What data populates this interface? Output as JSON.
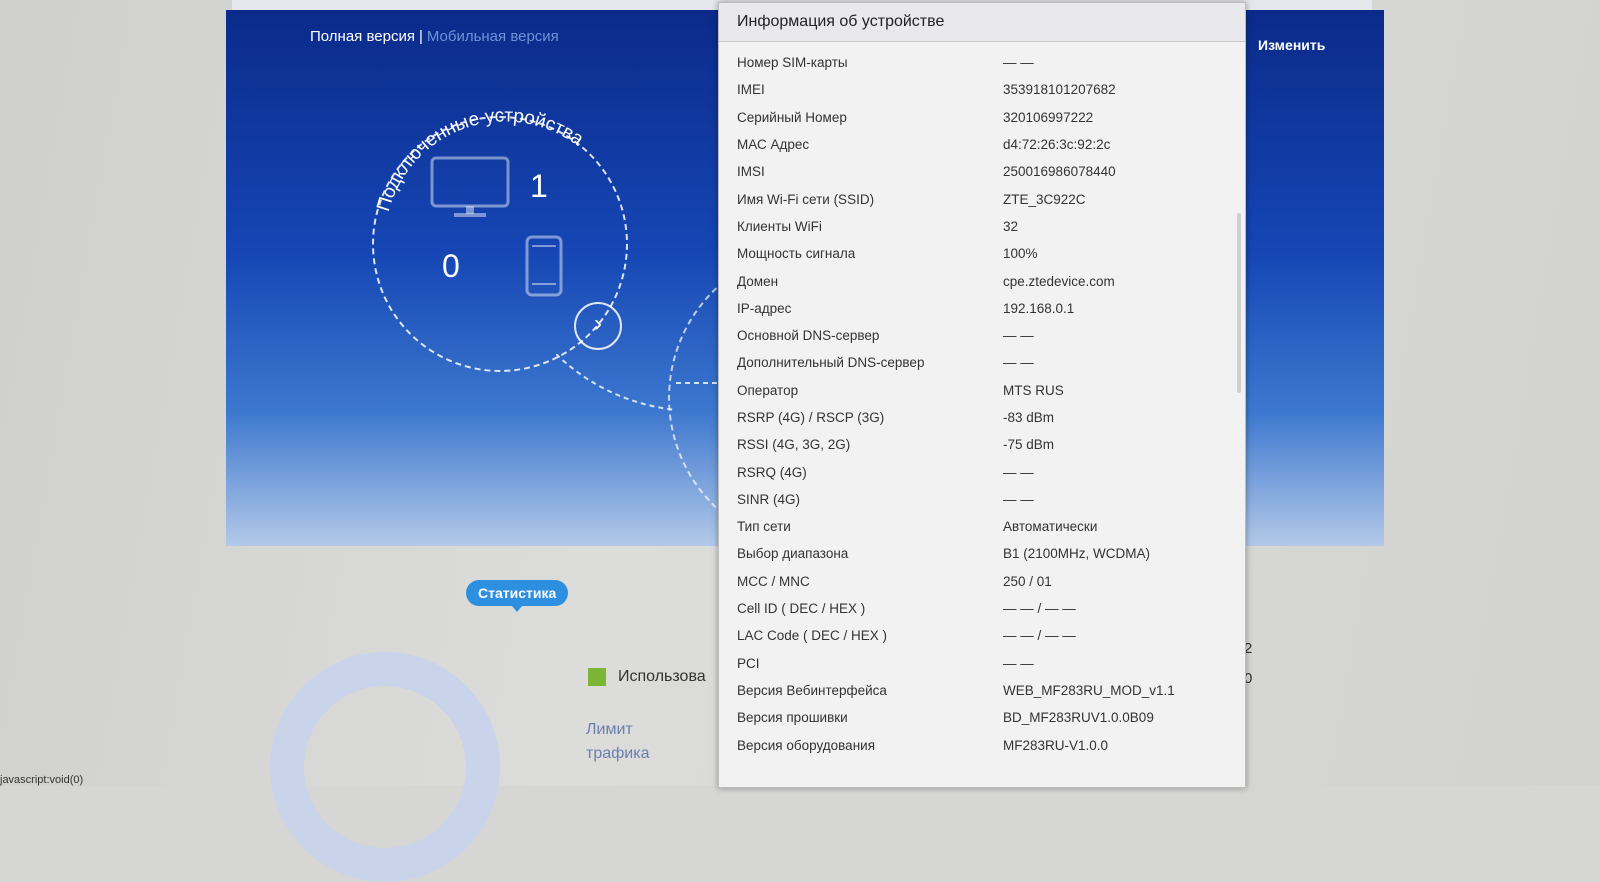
{
  "header": {
    "full_version": "Полная версия",
    "separator": "|",
    "mobile_version": "Мобильная версия",
    "edit_link": "Изменить"
  },
  "devices": {
    "title": "Подключенные устройства",
    "wired_count": "1",
    "wireless_count": "0",
    "arrow": "›"
  },
  "statistics": {
    "badge": "Статистика",
    "used_label": "Использова",
    "limit_label": "Лимит трафика",
    "right_numbers": [
      "2",
      "0"
    ],
    "used_color": "#7cb436"
  },
  "status_bar": "javascript:void(0)",
  "modal": {
    "title": "Информация об устройстве",
    "rows": [
      {
        "label": "Номер SIM-карты",
        "value": "— —"
      },
      {
        "label": "IMEI",
        "value": "353918101207682"
      },
      {
        "label": "Серийный Номер",
        "value": "320106997222"
      },
      {
        "label": "МАС Адрес",
        "value": "d4:72:26:3c:92:2c"
      },
      {
        "label": "IMSI",
        "value": "250016986078440"
      },
      {
        "label": "Имя Wi-Fi сети (SSID)",
        "value": "ZTE_3C922C"
      },
      {
        "label": "Клиенты WiFi",
        "value": "32"
      },
      {
        "label": "Мощность сигнала",
        "value": "100%"
      },
      {
        "label": "Домен",
        "value": "cpe.ztedevice.com"
      },
      {
        "label": "IP-адрес",
        "value": "192.168.0.1"
      },
      {
        "label": "Основной DNS-сервер",
        "value": "— —"
      },
      {
        "label": "Дополнительный DNS-сервер",
        "value": "— —"
      },
      {
        "label": "Оператор",
        "value": "MTS RUS"
      },
      {
        "label": "RSRP (4G) / RSCP (3G)",
        "value": "-83 dBm"
      },
      {
        "label": "RSSI (4G, 3G, 2G)",
        "value": "-75 dBm"
      },
      {
        "label": "RSRQ (4G)",
        "value": "— —"
      },
      {
        "label": "SINR (4G)",
        "value": "— —"
      },
      {
        "label": "Тип сети",
        "value": "Автоматически"
      },
      {
        "label": "Выбор диапазона",
        "value": "B1 (2100MHz, WCDMA)"
      },
      {
        "label": "MCC / MNC",
        "value": "250 / 01"
      },
      {
        "label": "Cell ID ( DEC / HEX )",
        "value": "— — / — —"
      },
      {
        "label": "LAC Code ( DEC / HEX )",
        "value": "— — / — —"
      },
      {
        "label": "PCI",
        "value": "— —"
      },
      {
        "label": "Версия Вебинтерфейса",
        "value": "WEB_MF283RU_MOD_v1.1"
      },
      {
        "label": "Версия прошивки",
        "value": "BD_MF283RUV1.0.0B09"
      },
      {
        "label": "Версия оборудования",
        "value": "MF283RU-V1.0.0"
      }
    ]
  }
}
